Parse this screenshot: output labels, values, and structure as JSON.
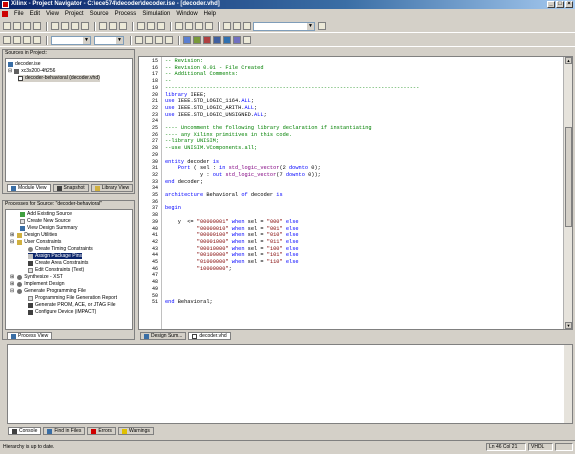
{
  "window": {
    "title": "Xilinx - Project Navigator - C:\\ece574\\decoder\\decoder.ise - [decoder.vhd]"
  },
  "menu": [
    "File",
    "Edit",
    "View",
    "Project",
    "Source",
    "Process",
    "Simulation",
    "Window",
    "Help"
  ],
  "sources_panel": {
    "title": "Sources in Project:",
    "items": [
      "decoder.ise",
      "xc3s200-4ft256",
      "decoder-behavioral (decoder.vhd)"
    ],
    "tabs": [
      "Module View",
      "Snapshot",
      "Library View"
    ]
  },
  "processes_panel": {
    "title": "Processes for Source: \"decoder-behavioral\"",
    "items": [
      "Add Existing Source",
      "Create New Source",
      "View Design Summary",
      "Design Utilities",
      "User Constraints",
      "Create Timing Constraints",
      "Assign Package Pins",
      "Create Area Constraints",
      "Edit Constraints (Text)",
      "Synthesize - XST",
      "Implement Design",
      "Generate Programming File",
      "Programming File Generation Report",
      "Generate PROM, ACE, or JTAG File",
      "Configure Device (iMPACT)"
    ],
    "selected_index": 6,
    "tab": "Process View"
  },
  "editor": {
    "line_numbers": [
      "15",
      "16",
      "17",
      "18",
      "19",
      "20",
      "21",
      "22",
      "23",
      "24",
      "25",
      "26",
      "27",
      "28",
      "29",
      "30",
      "31",
      "32",
      "33",
      "34",
      "35",
      "36",
      "37",
      "38",
      "39",
      "40",
      "41",
      "42",
      "43",
      "44",
      "45",
      "46",
      "47",
      "48",
      "49",
      "50",
      "51"
    ],
    "tabs": [
      "Design Sum...",
      "decoder.vhd"
    ]
  },
  "console_tabs": [
    "Console",
    "Find in Files",
    "Errors",
    "Warnings"
  ],
  "status": {
    "message": "Hierarchy is up to date.",
    "position": "Ln 46 Col 21",
    "mode": "VHDL"
  }
}
